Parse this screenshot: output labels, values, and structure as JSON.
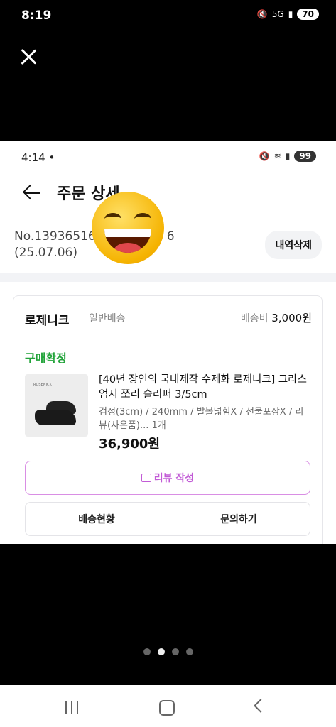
{
  "outer_status": {
    "time": "8:19",
    "battery": "70",
    "network": "5G"
  },
  "inner_status": {
    "time": "4:14",
    "battery": "99"
  },
  "header": {
    "title": "주문 상세"
  },
  "order": {
    "number": "No.13936516",
    "number_tail": "6",
    "date": "(25.07.06)",
    "delete_label": "내역삭제"
  },
  "store": {
    "name": "로제니크",
    "shipping_type": "일반배송",
    "shipping_fee_label": "배송비",
    "shipping_fee": "3,000원"
  },
  "item": {
    "status": "구매확정",
    "thumb_brand": "ROSENICK",
    "title": "[40년 장인의 국내제작 수제화 로제니크] 그라스 엄지 쪼리 슬리퍼 3/5cm",
    "options": "검정(3cm) / 240mm / 발볼넓힘X / 선물포장X / 리뷰(사은품)...",
    "quantity": "1개",
    "price": "36,900원"
  },
  "actions": {
    "review_label": "리뷰 작성",
    "tracking_label": "배송현황",
    "inquiry_label": "문의하기"
  },
  "pager": {
    "count": 4,
    "active_index": 1
  }
}
